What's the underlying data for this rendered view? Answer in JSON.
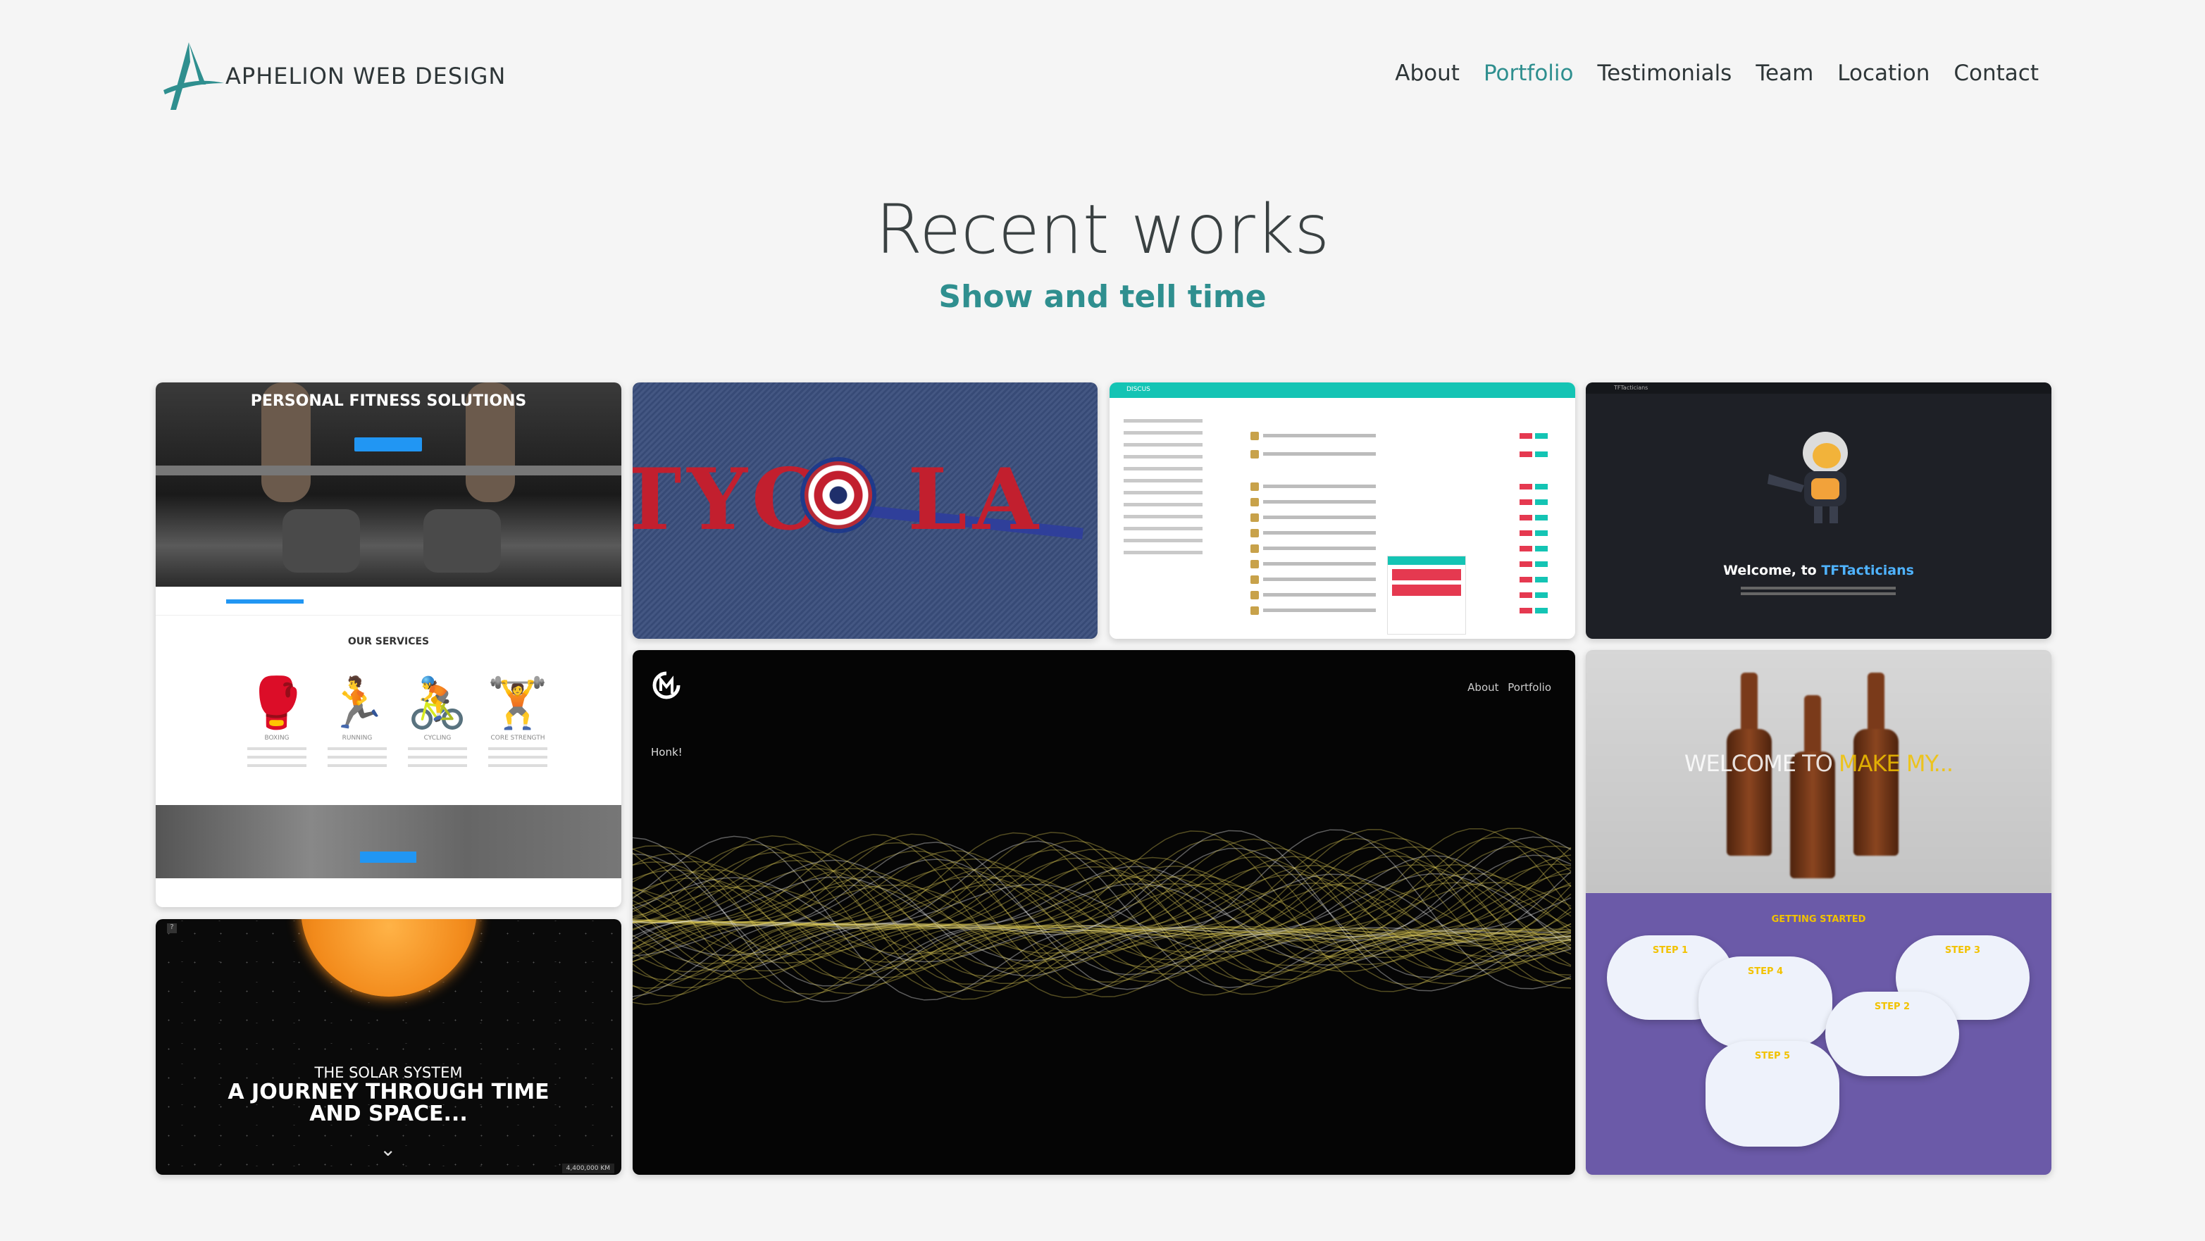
{
  "brand": {
    "name": "APHELION WEB DESIGN"
  },
  "nav": [
    {
      "label": "About",
      "active": false
    },
    {
      "label": "Portfolio",
      "active": true
    },
    {
      "label": "Testimonials",
      "active": false
    },
    {
      "label": "Team",
      "active": false
    },
    {
      "label": "Location",
      "active": false
    },
    {
      "label": "Contact",
      "active": false
    }
  ],
  "section": {
    "title": "Recent works",
    "subtitle": "Show and tell time"
  },
  "colors": {
    "accent": "#2f8f8f",
    "text": "#2e3638",
    "background": "#f5f5f5"
  },
  "portfolio": {
    "fitness": {
      "hero_title": "PERSONAL FITNESS SOLUTIONS",
      "services_heading": "OUR SERVICES",
      "services": [
        "BOXING",
        "RUNNING",
        "CYCLING",
        "CORE STRENGTH"
      ]
    },
    "tycola": {
      "text_left": "TYC",
      "text_right": "LA"
    },
    "discus": {
      "app_name": "DISCUS"
    },
    "tft": {
      "app_name": "TFTacticians",
      "welcome_prefix": "Welcome, to ",
      "welcome_brand": "TFTacticians"
    },
    "solar": {
      "subtitle": "THE SOLAR SYSTEM",
      "title_line1": "A JOURNEY THROUGH TIME",
      "title_line2": "AND SPACE...",
      "distance": "4,400,000 KM"
    },
    "wave": {
      "nav": "About Portfolio",
      "caption": "Honk!"
    },
    "beer": {
      "title_prefix": "WELCOME TO ",
      "title_brand": "MAKE MY...",
      "section": "GETTING STARTED",
      "steps": [
        "STEP 1",
        "STEP 2",
        "STEP 3",
        "STEP 4",
        "STEP 5"
      ]
    }
  }
}
